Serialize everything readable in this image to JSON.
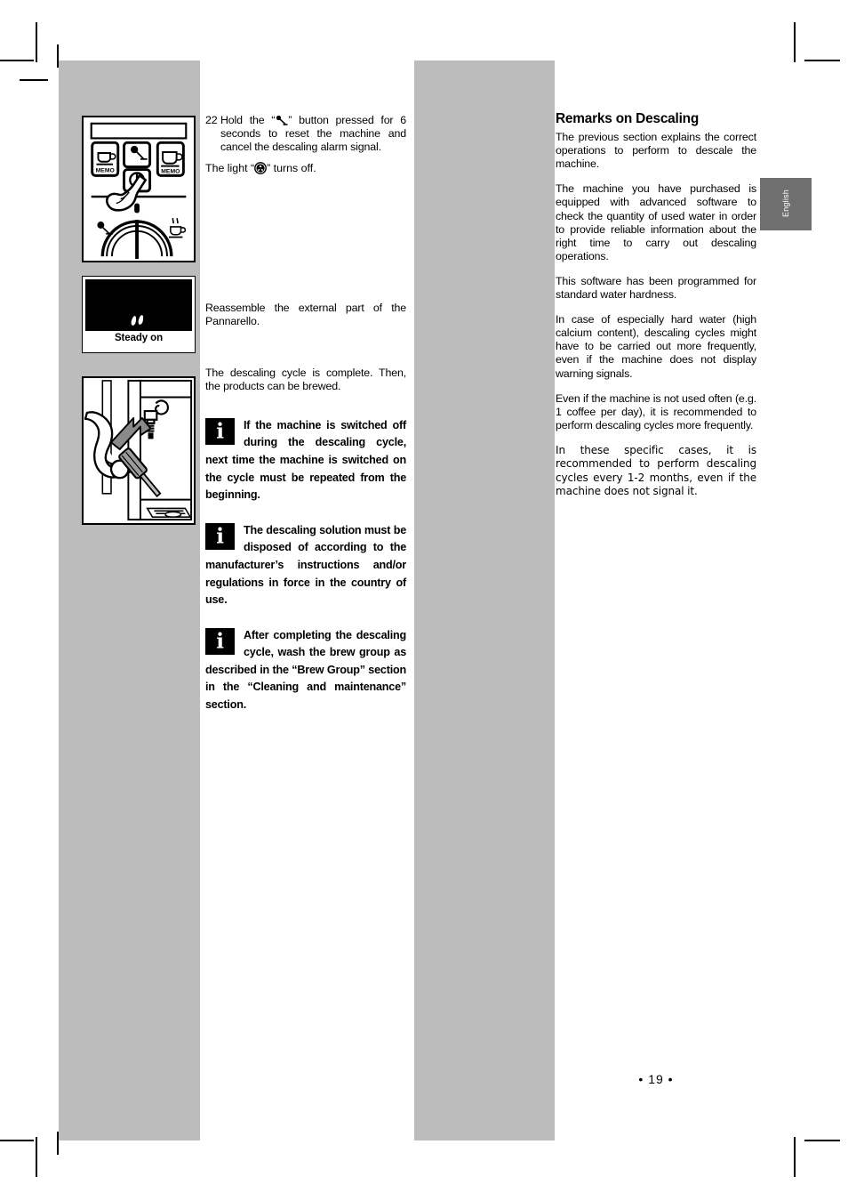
{
  "page": {
    "number_label": "• 19 •",
    "language_tab": "English"
  },
  "figures": {
    "control_panel": {
      "name": "machine control panel with finger pressing steam button",
      "buttons": [
        {
          "label": "MEMO",
          "icon": "small-cup-icon"
        },
        {
          "label": "",
          "icon": "steam-clean-icon"
        },
        {
          "label": "MEMO",
          "icon": "large-cup-icon"
        }
      ],
      "power_icon": "power-standby-icon",
      "dial_left_icon": "steam-knob-icon",
      "dial_right_icon": "hot-water-cup-icon"
    },
    "steady_on": {
      "caption": "Steady on",
      "display_icon": "two-coffee-beans-icon"
    },
    "pannarello": {
      "name": "hand reassembling external part of Pannarello",
      "arrow_icon": "up-left-arrow-icon"
    }
  },
  "middle_column": {
    "step_number": "22",
    "step_text_before_glyph": "Hold the “",
    "step_glyph_1": "steam-clean-icon",
    "step_text_after_glyph": "” button pressed for 6 seconds to reset the machine and cancel the descaling alarm signal.",
    "light_text_before_glyph": "The light “",
    "light_glyph": "descaling-alarm-icon",
    "light_text_after_glyph": "” turns off.",
    "pannarello_text": "Reassemble the external part of the Pannarello.",
    "cycle_complete_text": "The descaling cycle is complete. Then, the products can be brewed.",
    "notes": [
      {
        "icon": "info-icon",
        "text": "If the machine is switched off during the descaling cycle, next time the machine is switched on the cycle must be repeated from the beginning."
      },
      {
        "icon": "info-icon",
        "text": "The descaling solution must be disposed of according to the manufacturer’s instructions and/or regulations in force in the country of use."
      },
      {
        "icon": "info-icon",
        "text": "After completing the descaling cycle, wash the brew group as described in the “Brew Group” section in the “Cleaning and maintenance” section."
      }
    ]
  },
  "right_column": {
    "heading": "Remarks on Descaling",
    "paragraphs": [
      "The previous section explains the correct operations to perform to descale the machine.",
      "The machine you have purchased is equipped with advanced software to check the quantity of used water in order to provide reliable information about the right time to carry out descaling operations.",
      "This software has been programmed for standard water hardness.",
      "In case of especially hard water (high calcium content), descaling cycles might have to be carried out more frequently, even if the machine does not display warning signals.",
      "Even if the machine is not used often (e.g. 1 coffee per day), it is recommended to perform descaling cycles more frequently.",
      "In these specific cases, it is recommended to perform descaling cycles every 1-2 months, even if the machine does not signal it."
    ]
  },
  "colors": {
    "band_gray": "#bcbcbc",
    "tab_gray": "#6f6f6f",
    "ink": "#000000",
    "paper": "#ffffff"
  }
}
